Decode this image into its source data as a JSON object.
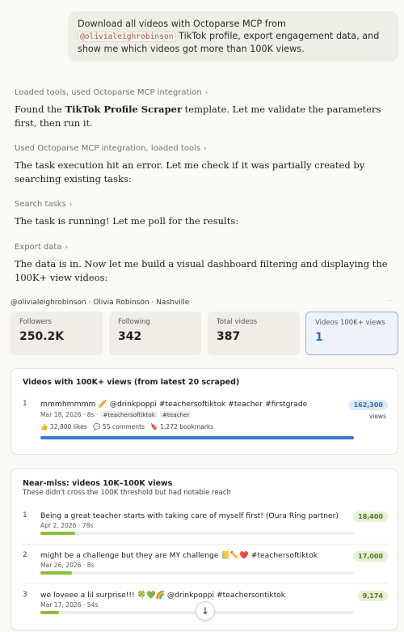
{
  "user_message": {
    "before": "Download all videos with Octoparse MCP from",
    "handle": "@olivialeighrobinson",
    "after": " TikTok profile, export engagement data, and show me which videos got more than 100K views."
  },
  "tool_lines": [
    "Loaded tools, used Octoparse MCP integration",
    "Used Octoparse MCP integration, loaded tools",
    "Search tasks",
    "Export data"
  ],
  "assistant": {
    "msg1_pre": "Found the ",
    "msg1_bold": "TikTok Profile Scraper",
    "msg1_post": " template. Let me validate the parameters first, then run it.",
    "msg2": "The task execution hit an error. Let me check if it was partially created by searching existing tasks:",
    "msg3": "The task is running! Let me poll for the results:",
    "msg4": "The data is in. Now let me build a visual dashboard filtering and displaying the 100K+ view videos:"
  },
  "dashboard": {
    "profile_line": "@olivialeighrobinson · Olivia Robinson · Nashville",
    "stats": [
      {
        "label": "Followers",
        "value": "250.2K"
      },
      {
        "label": "Following",
        "value": "342"
      },
      {
        "label": "Total videos",
        "value": "387"
      },
      {
        "label": "Videos 100K+ views",
        "value": "1"
      }
    ],
    "top_card": {
      "title": "Videos with 100K+ views (from latest 20 scraped)",
      "rows": [
        {
          "num": "1",
          "title": "mmmhmmmm 🥖 @drinkpoppi #teachersoftiktok #teacher #firstgrade",
          "meta": "Mar 18, 2026 · 8s ·",
          "tags": [
            "#teachersoftiktok",
            "#teacher"
          ],
          "likes": "👍 32,800 likes",
          "comments": "💬 55 comments",
          "bookmarks": "🔖 1,272 bookmarks",
          "views": "162,300",
          "views_unit": "views",
          "bar_fraction": 1.0
        }
      ]
    },
    "near_card": {
      "title": "Near-miss: videos 10K–100K views",
      "subtitle": "These didn't cross the 100K threshold but had notable reach",
      "rows": [
        {
          "num": "1",
          "title": "Being a great teacher starts with taking care of myself first! (Oura Ring partner)",
          "meta": "Apr 2, 2026 · 78s",
          "views": "18,400",
          "bar_fraction": 0.11
        },
        {
          "num": "2",
          "title": "might be a challenge but they are MY challenge 📒✏️❤️ #teachersoftiktok",
          "meta": "Mar 26, 2026 · 8s",
          "views": "17,000",
          "bar_fraction": 0.1
        },
        {
          "num": "3",
          "title": "we loveee a lil surprise!!! 🍀💚🌈 @drinkpoppi #teachersontiktok",
          "meta": "Mar 17, 2026 · 54s",
          "views": "9,174",
          "bar_fraction": 0.06
        }
      ]
    }
  },
  "colors": {
    "accent_blue": "#3a7bd5",
    "accent_green": "#8cbf3f"
  },
  "icons": {
    "chevron": "›",
    "scroll_down": "↓"
  }
}
